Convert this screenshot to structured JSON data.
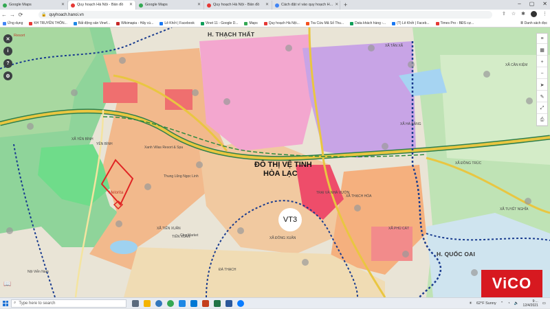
{
  "tabs": [
    {
      "title": "Google Maps",
      "color": "#34a853",
      "active": false
    },
    {
      "title": "Quy hoạch Hà Nội - Bản đồ",
      "color": "#e53935",
      "active": true
    },
    {
      "title": "Google Maps",
      "color": "#34a853",
      "active": false
    },
    {
      "title": "Quy hoạch Hà Nội - Bản đồ",
      "color": "#e53935",
      "active": false
    },
    {
      "title": "Cách đặt ví vào quy hoạch H...",
      "color": "#4285f4",
      "active": false
    }
  ],
  "address": {
    "url": "quyhoach.hanoi.vn"
  },
  "bookmarks": [
    {
      "label": "Ứng dụng",
      "color": "#4285f4"
    },
    {
      "label": "KH TRUYỀN THÔN...",
      "color": "#e53935"
    },
    {
      "label": "Bất động sản Vinef...",
      "color": "#1e88e5"
    },
    {
      "label": "Wikimapia - Hãy cù...",
      "color": "#c62828"
    },
    {
      "label": "Lê Khởi | Facebook",
      "color": "#1877f2"
    },
    {
      "label": "Vinet 11 - Google D...",
      "color": "#0f9d58"
    },
    {
      "label": "Maps",
      "color": "#34a853"
    },
    {
      "label": "Quy hoạch Hà Nội...",
      "color": "#e53935"
    },
    {
      "label": "Tra Cứu Mã Số Thu...",
      "color": "#f4511e"
    },
    {
      "label": "Data khách hàng -...",
      "color": "#0f9d58"
    },
    {
      "label": "(T) Lê Khởi | Faceb...",
      "color": "#1877f2"
    },
    {
      "label": "Times Pro - BĐS cự...",
      "color": "#e53935"
    }
  ],
  "bookmarks_right": "Danh sách đọc",
  "map": {
    "resort": "Resort",
    "district_thach_that": "H. THẠCH THẤT",
    "district_quoc_oai": "H. QUỐC OAI",
    "city_title_1": "ĐÔ THỊ VỆ TINH",
    "city_title_2": "HÒA LẠC",
    "vt3": "VT3",
    "melorita": "Melorita",
    "labels": [
      {
        "t": "XÃ YÊN BÌNH"
      },
      {
        "t": "XÃ TIẾN XUÂN"
      },
      {
        "t": "TIẾN XUÂN"
      },
      {
        "t": "XÃ ĐÔNG XUÂN"
      },
      {
        "t": "XÃ THẠCH HÒA"
      },
      {
        "t": "XÃ HÀ BẰNG"
      },
      {
        "t": "XÃ ĐỒNG TRÚC"
      },
      {
        "t": "XÃ CẦN KIỆM"
      },
      {
        "t": "XÃ PHÚ CÁT"
      },
      {
        "t": "XÃ TUYẾT NGHĨA"
      },
      {
        "t": "Xanh Villas Resort & Spa"
      },
      {
        "t": "Thung Lũng Ngọc Linh"
      },
      {
        "t": "Chợ Market"
      },
      {
        "t": "ĐÀ THẠCH"
      },
      {
        "t": "XÃ TÂN XÃ"
      },
      {
        "t": "YÊN BÌNH"
      },
      {
        "t": "Nội Viễn Nam"
      },
      {
        "t": "TRẠI VÀ NHÀ VƯỜN"
      }
    ]
  },
  "taskbar": {
    "search_placeholder": "Type here to search",
    "weather": "62°F  Sunny",
    "time": "9:...",
    "date": "12/4/2021"
  },
  "logo": "ViCO",
  "colors": {
    "accent": "#d71920",
    "highway": "#e9c641",
    "boundary": "#1a3c8f"
  }
}
